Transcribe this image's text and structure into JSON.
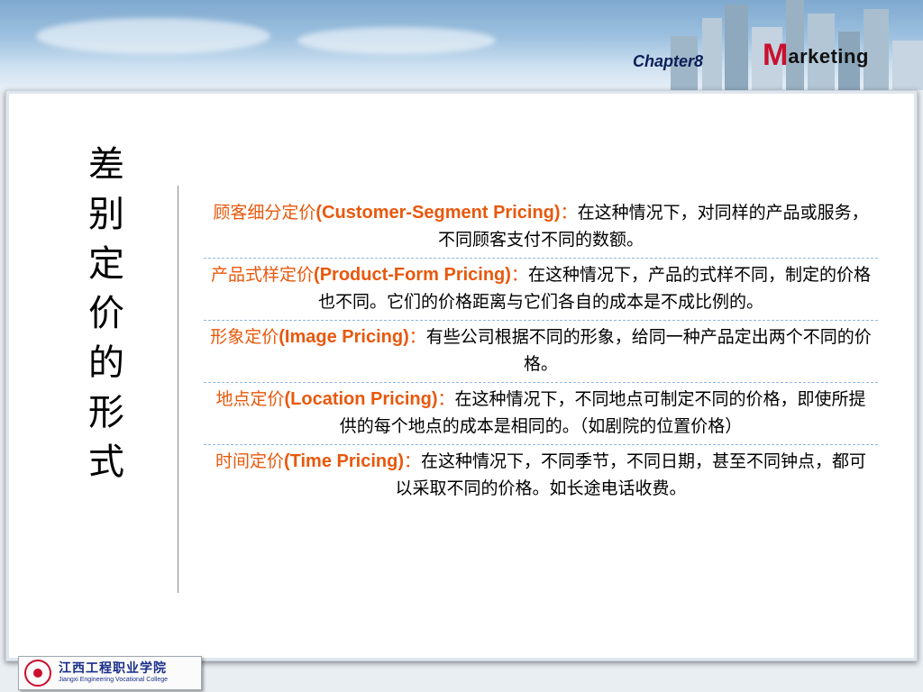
{
  "header": {
    "chapter": "Chapter8",
    "brand_initial": "M",
    "brand_rest": "arketing"
  },
  "side_title": [
    "差",
    "别",
    "定",
    "价",
    "的",
    "形",
    "式"
  ],
  "items": [
    {
      "term_cn": "顾客细分定价",
      "term_en": "(Customer-Segment Pricing)",
      "colon": "：",
      "desc": "在这种情况下，对同样的产品或服务，不同顾客支付不同的数额。"
    },
    {
      "term_cn": "产品式样定价",
      "term_en": "(Product-Form Pricing)",
      "colon": "：",
      "desc": "在这种情况下，产品的式样不同，制定的价格也不同。它们的价格距离与它们各自的成本是不成比例的。"
    },
    {
      "term_cn": "形象定价",
      "term_en": "(Image Pricing)",
      "colon": "：",
      "desc": "有些公司根据不同的形象，给同一种产品定出两个不同的价格。"
    },
    {
      "term_cn": "地点定价",
      "term_en": "(Location Pricing)",
      "colon": "：",
      "desc": "在这种情况下，不同地点可制定不同的价格，即使所提供的每个地点的成本是相同的。（如剧院的位置价格）"
    },
    {
      "term_cn": "时间定价",
      "term_en": "(Time Pricing)",
      "colon": "：",
      "desc": "在这种情况下，不同季节，不同日期，甚至不同钟点，都可以采取不同的价格。如长途电话收费。"
    }
  ],
  "footer": {
    "logo_cn": "江西工程职业学院",
    "logo_en": "Jiangxi Engineering Vocational College"
  },
  "colors": {
    "term": "#e8580c",
    "chapter": "#0b1f57",
    "brand_initial": "#c8102e",
    "divider": "#8fb8e0"
  },
  "icons": {
    "footer_seal": "college-seal-icon",
    "header_art": "city-skyline-icon"
  }
}
